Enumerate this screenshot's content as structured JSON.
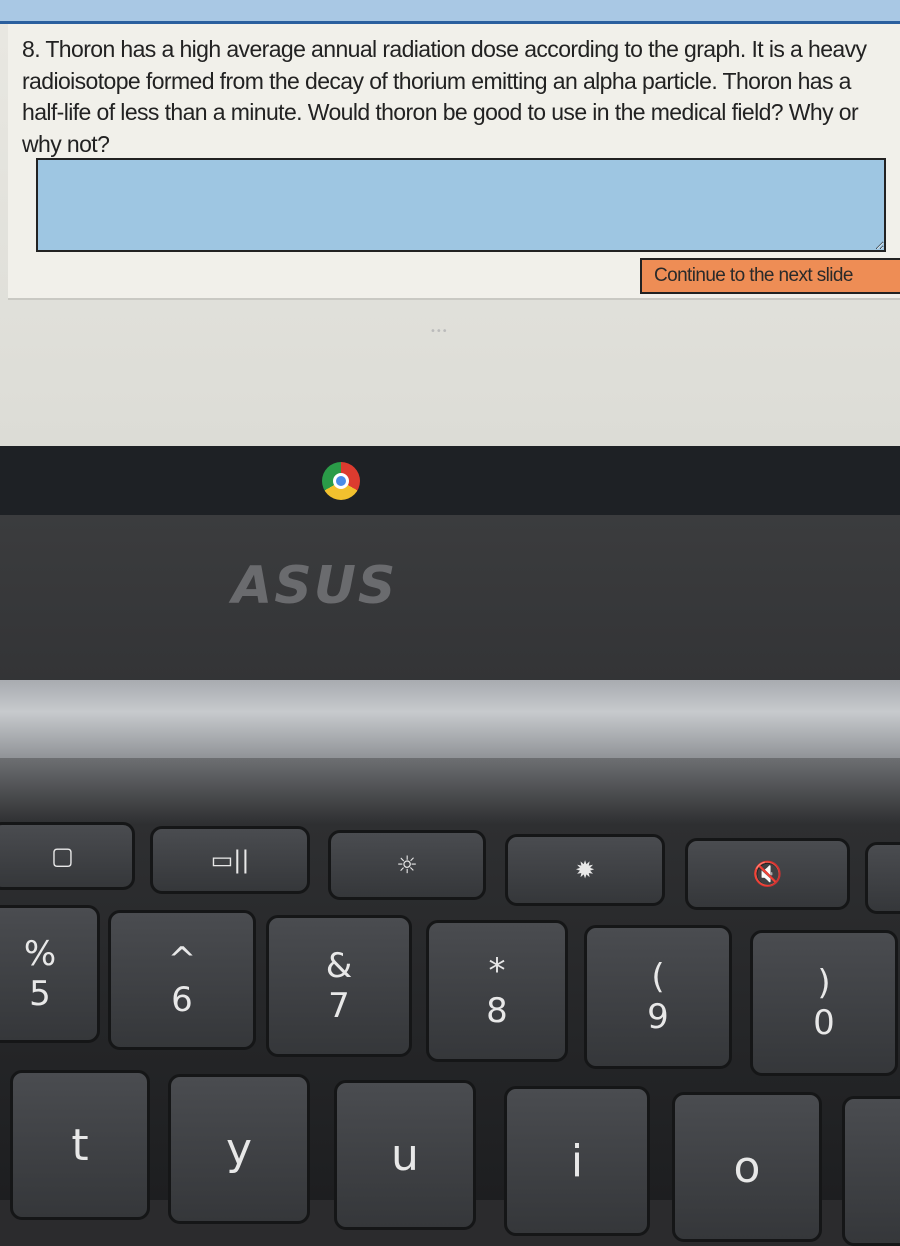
{
  "slide": {
    "question": "8. Thoron has a high average annual radiation dose according to the graph. It is a heavy radioisotope formed from the decay of thorium emitting an alpha particle. Thoron has a half-life of less than a minute. Would thoron be good to use in the medical field? Why or why not?",
    "answer_value": "",
    "continue_label": "Continue to the next slide",
    "dots": "•••"
  },
  "shelf": {
    "app_icon": "chrome-icon"
  },
  "bezel": {
    "logo": "ASUS"
  },
  "keyboard": {
    "function_row": [
      {
        "icon": "fullscreen-icon",
        "glyph": "▢"
      },
      {
        "icon": "overview-icon",
        "glyph": "▭||"
      },
      {
        "icon": "brightness-down-icon",
        "glyph": "☼"
      },
      {
        "icon": "brightness-up-icon",
        "glyph": "✹"
      },
      {
        "icon": "mute-icon",
        "glyph": "🔇"
      }
    ],
    "number_row": [
      {
        "top": "%",
        "bottom": "5"
      },
      {
        "top": "^",
        "bottom": "6"
      },
      {
        "top": "&",
        "bottom": "7"
      },
      {
        "top": "*",
        "bottom": "8"
      },
      {
        "top": "(",
        "bottom": "9"
      },
      {
        "top": ")",
        "bottom": "0"
      }
    ],
    "letter_row": [
      "t",
      "y",
      "u",
      "i",
      "o"
    ]
  },
  "colors": {
    "answer_box": "#9ec6e2",
    "continue_button": "#ee8d55"
  }
}
